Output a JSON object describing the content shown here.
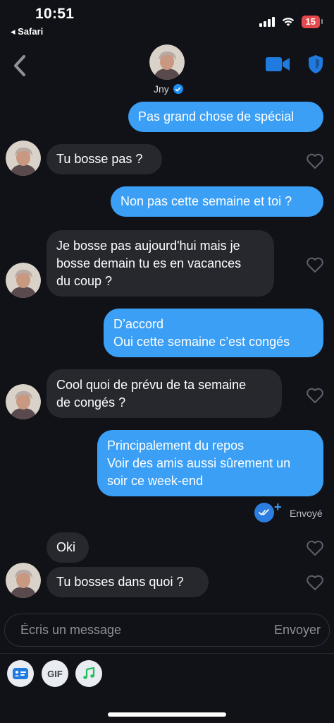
{
  "status_bar": {
    "time": "10:51",
    "back_app": "◂ Safari",
    "battery": "15",
    "battery_color": "#e5484d"
  },
  "header": {
    "name": "Jny",
    "verified": true,
    "icons": [
      "chevron-left-icon",
      "video-camera-icon",
      "shield-icon",
      "verified-badge-icon"
    ],
    "accent": "#1f7be0"
  },
  "messages": [
    {
      "from": "me",
      "text": "Pas grand chose de spécial"
    },
    {
      "from": "them",
      "text": "Tu bosse pas ?"
    },
    {
      "from": "me",
      "text": "Non pas cette semaine et toi ?"
    },
    {
      "from": "them",
      "text": "Je bosse pas aujourd'hui mais je\nbosse demain tu es en vacances\ndu coup ?"
    },
    {
      "from": "me",
      "text": "D’accord\nOui cette semaine c’est congés"
    },
    {
      "from": "them",
      "text": "Cool quoi de prévu de ta semaine\nde congés ?"
    },
    {
      "from": "me",
      "text": "Principalement du repos\nVoir des amis aussi sûrement un\nsoir ce week-end"
    },
    {
      "from": "them",
      "text": "Oki"
    },
    {
      "from": "them",
      "text": "Tu bosses dans quoi ?"
    }
  ],
  "sent_status": "Envoyé",
  "composer": {
    "placeholder": "Écris un message",
    "send_label": "Envoyer"
  },
  "toolbar": {
    "gif_label": "GIF",
    "icons": [
      "contact-card-icon",
      "gif-icon",
      "music-note-icon"
    ]
  },
  "colors": {
    "background": "#101217",
    "sent_bubble": "#3a9ff5",
    "received_bubble": "#26282e"
  }
}
